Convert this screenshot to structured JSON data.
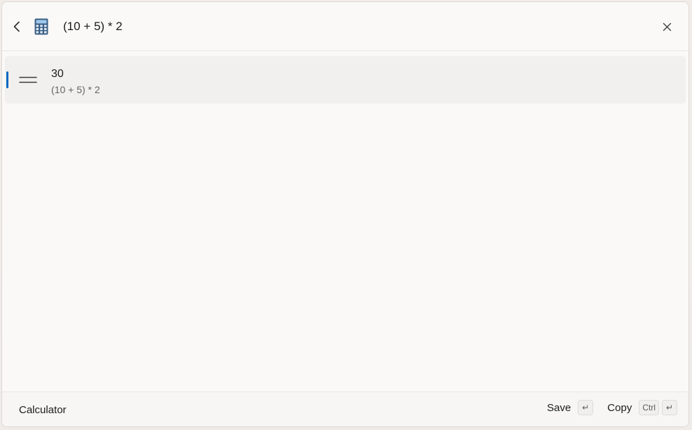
{
  "search": {
    "query": "(10 + 5) * 2"
  },
  "icons": {
    "back": "chevron-left-icon",
    "app": "calculator-icon",
    "close": "close-icon",
    "result": "equals-icon",
    "enter": "enter-key-icon"
  },
  "results": [
    {
      "title": "30",
      "subtitle": "(10 + 5) * 2",
      "selected": true
    }
  ],
  "footer": {
    "plugin_name": "Calculator",
    "actions": [
      {
        "label": "Save",
        "keys": [
          "↵"
        ]
      },
      {
        "label": "Copy",
        "keys": [
          "Ctrl",
          "↵"
        ]
      }
    ]
  },
  "colors": {
    "accent": "#0067c0"
  }
}
